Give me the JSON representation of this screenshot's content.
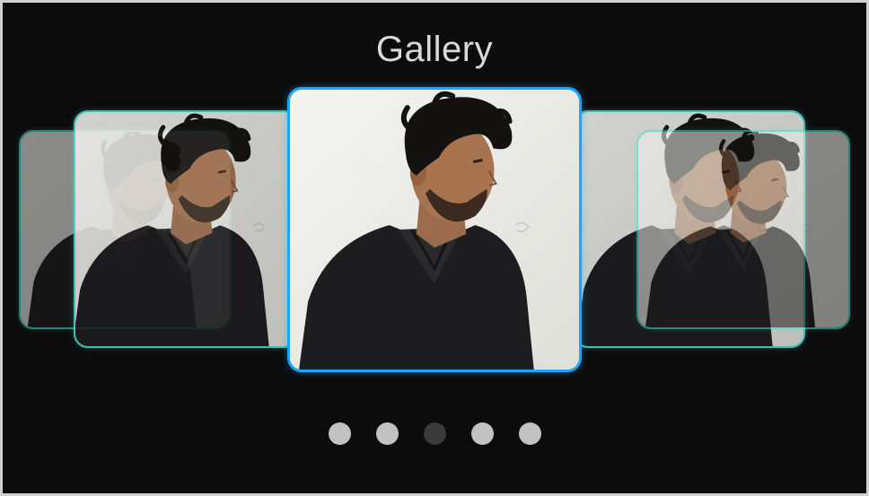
{
  "gallery": {
    "title": "Gallery",
    "slides": [
      {
        "label": "slide-1"
      },
      {
        "label": "slide-2"
      },
      {
        "label": "slide-3"
      },
      {
        "label": "slide-4"
      },
      {
        "label": "slide-5"
      }
    ],
    "active_index": 2,
    "accent_center": "#1ea3ff",
    "accent_side": "#3fe3cf",
    "background": "#0c0c0c"
  }
}
